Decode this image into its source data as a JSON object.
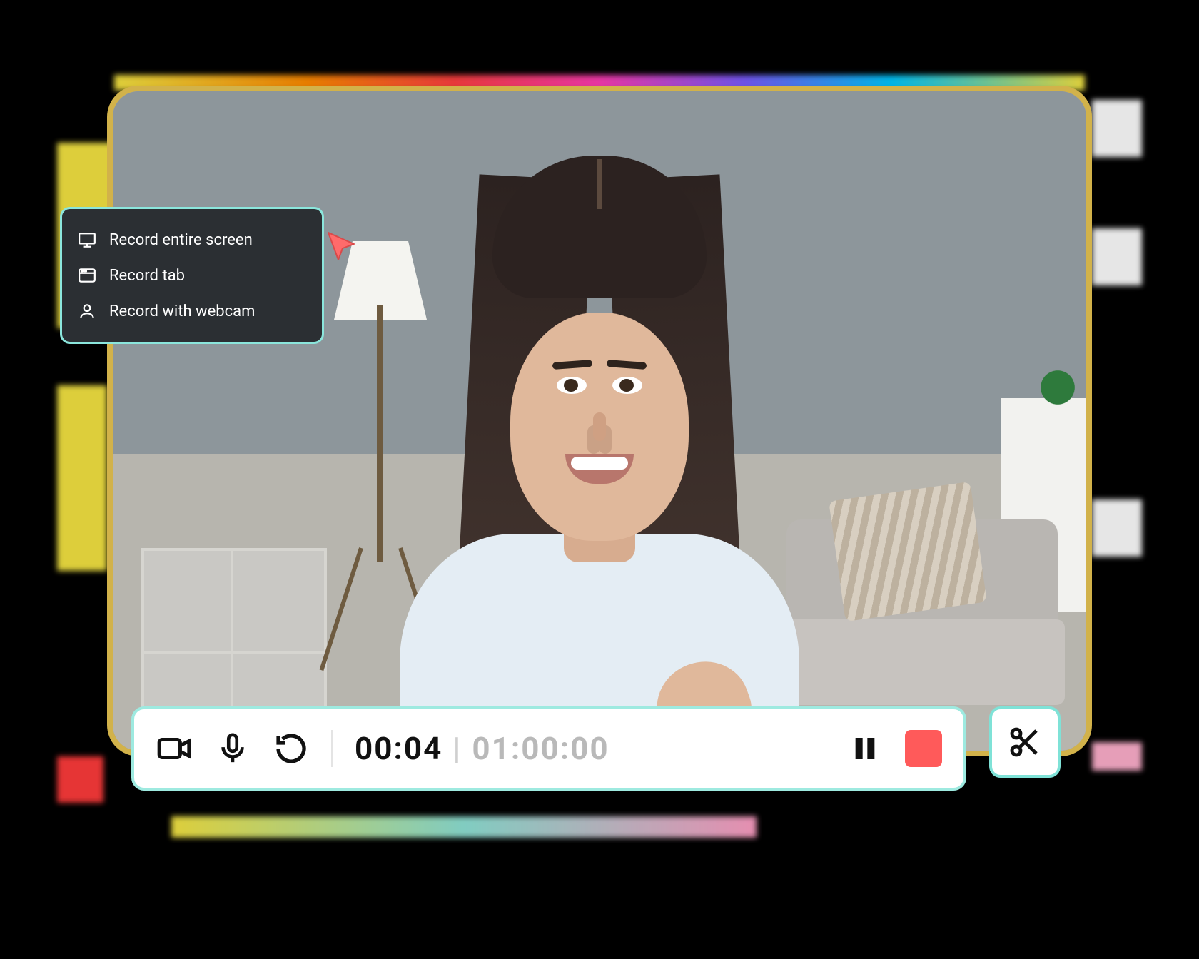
{
  "menu": {
    "items": [
      {
        "icon": "monitor-icon",
        "label": "Record entire screen"
      },
      {
        "icon": "browser-tab-icon",
        "label": "Record tab"
      },
      {
        "icon": "person-icon",
        "label": "Record with webcam"
      }
    ]
  },
  "controls": {
    "elapsed": "00:04",
    "separator": "|",
    "total": "01:00:00"
  },
  "colors": {
    "menu_border": "#8be6dc",
    "bar_border": "#9eeae0",
    "frame_border": "#d2b24a",
    "stop": "#ff5a5a",
    "cursor": "#ff6b6b"
  }
}
